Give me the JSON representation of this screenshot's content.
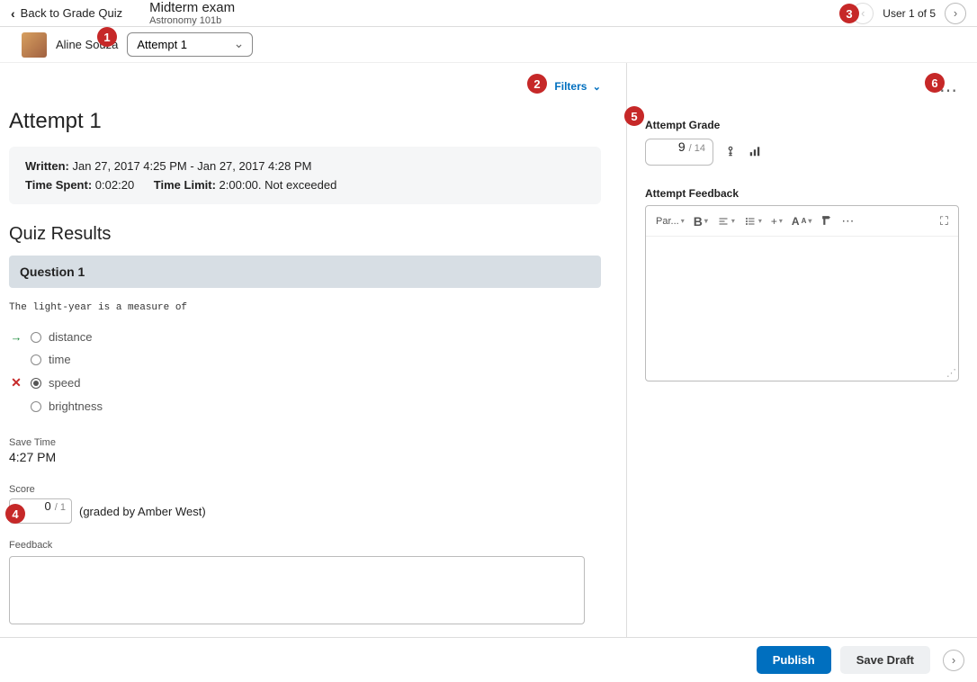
{
  "header": {
    "back_label": "Back to Grade Quiz",
    "quiz_title": "Midterm exam",
    "course": "Astronomy 101b",
    "user_counter": "User 1 of 5"
  },
  "user_row": {
    "name": "Aline Souza",
    "attempt_selected": "Attempt 1"
  },
  "filters_label": "Filters",
  "attempt": {
    "heading": "Attempt 1",
    "written_label": "Written:",
    "written_value": "Jan 27, 2017 4:25 PM - Jan 27, 2017 4:28 PM",
    "time_spent_label": "Time Spent:",
    "time_spent_value": "0:02:20",
    "time_limit_label": "Time Limit:",
    "time_limit_value": "2:00:00. Not exceeded"
  },
  "results": {
    "heading": "Quiz Results",
    "question_label": "Question 1",
    "question_text": "The light-year is a measure of",
    "options": [
      {
        "label": "distance",
        "selected": false,
        "indicator": "correct"
      },
      {
        "label": "time",
        "selected": false,
        "indicator": ""
      },
      {
        "label": "speed",
        "selected": true,
        "indicator": "wrong"
      },
      {
        "label": "brightness",
        "selected": false,
        "indicator": ""
      }
    ],
    "save_time_label": "Save Time",
    "save_time_value": "4:27 PM",
    "score_label": "Score",
    "score_value": "0",
    "score_denom": "/ 1",
    "graded_by": "(graded by Amber West)",
    "feedback_label": "Feedback"
  },
  "right": {
    "attempt_grade_label": "Attempt Grade",
    "grade_value": "9",
    "grade_denom": "/ 14",
    "feedback_label": "Attempt Feedback",
    "toolbar_para": "Par..."
  },
  "footer": {
    "publish": "Publish",
    "save_draft": "Save Draft"
  },
  "badges": {
    "b1": "1",
    "b2": "2",
    "b3": "3",
    "b4": "4",
    "b5": "5",
    "b6": "6"
  }
}
